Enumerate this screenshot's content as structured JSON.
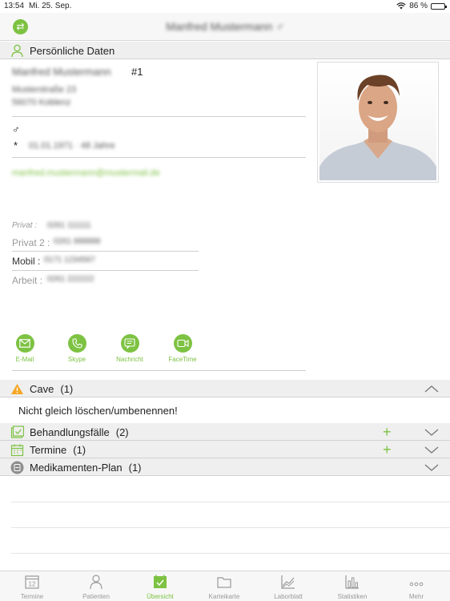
{
  "status_bar": {
    "time": "13:54",
    "date": "Mi. 25. Sep.",
    "battery": "86 %",
    "battery_level": 0.86
  },
  "nav": {
    "title": "Manfred Mustermann ♂"
  },
  "personal": {
    "header": "Persönliche Daten",
    "name": "Manfred Mustermann",
    "number": "#1",
    "address_line1": "Musterstraße 23",
    "address_line2": "56070 Koblenz",
    "gender_symbol": "♂",
    "birth_prefix": "*",
    "birth": "01.01.1971 · 48 Jahre",
    "email": "manfred.mustermann@mustermail.de",
    "phones": [
      {
        "label": "Privat",
        "value": "0261 111111"
      },
      {
        "label": "Privat 2",
        "value": "0261 888888"
      },
      {
        "label": "Mobil",
        "value": "0171 1234567"
      },
      {
        "label": "Arbeit",
        "value": "0261 222222"
      }
    ],
    "separator": " : "
  },
  "actions": [
    {
      "label": "E-Mail",
      "icon": "mail-icon"
    },
    {
      "label": "Skype",
      "icon": "phone-icon"
    },
    {
      "label": "Nachricht",
      "icon": "message-icon"
    },
    {
      "label": "FaceTime",
      "icon": "video-icon"
    }
  ],
  "sections": {
    "cave": {
      "label": "Cave",
      "count": "(1)",
      "note": "Nicht gleich löschen/umbenennen!"
    },
    "behandlungsfaelle": {
      "label": "Behandlungsfälle",
      "count": "(2)",
      "add": "+"
    },
    "termine": {
      "label": "Termine",
      "count": "(1)",
      "add": "+"
    },
    "medikamente": {
      "label": "Medikamenten-Plan",
      "count": "(1)"
    }
  },
  "tabs": [
    {
      "label": "Termine",
      "icon": "calendar-icon",
      "badge": "12"
    },
    {
      "label": "Patienten",
      "icon": "person-icon"
    },
    {
      "label": "Übersicht",
      "icon": "overview-icon",
      "active": true
    },
    {
      "label": "Karteikarte",
      "icon": "folder-icon"
    },
    {
      "label": "Laborblatt",
      "icon": "lab-chart-icon"
    },
    {
      "label": "Statistiken",
      "icon": "bar-chart-icon"
    },
    {
      "label": "Mehr",
      "icon": "more-icon"
    }
  ],
  "colors": {
    "accent": "#7dc242",
    "warning": "#f5a623",
    "header_bg": "#efefef"
  }
}
